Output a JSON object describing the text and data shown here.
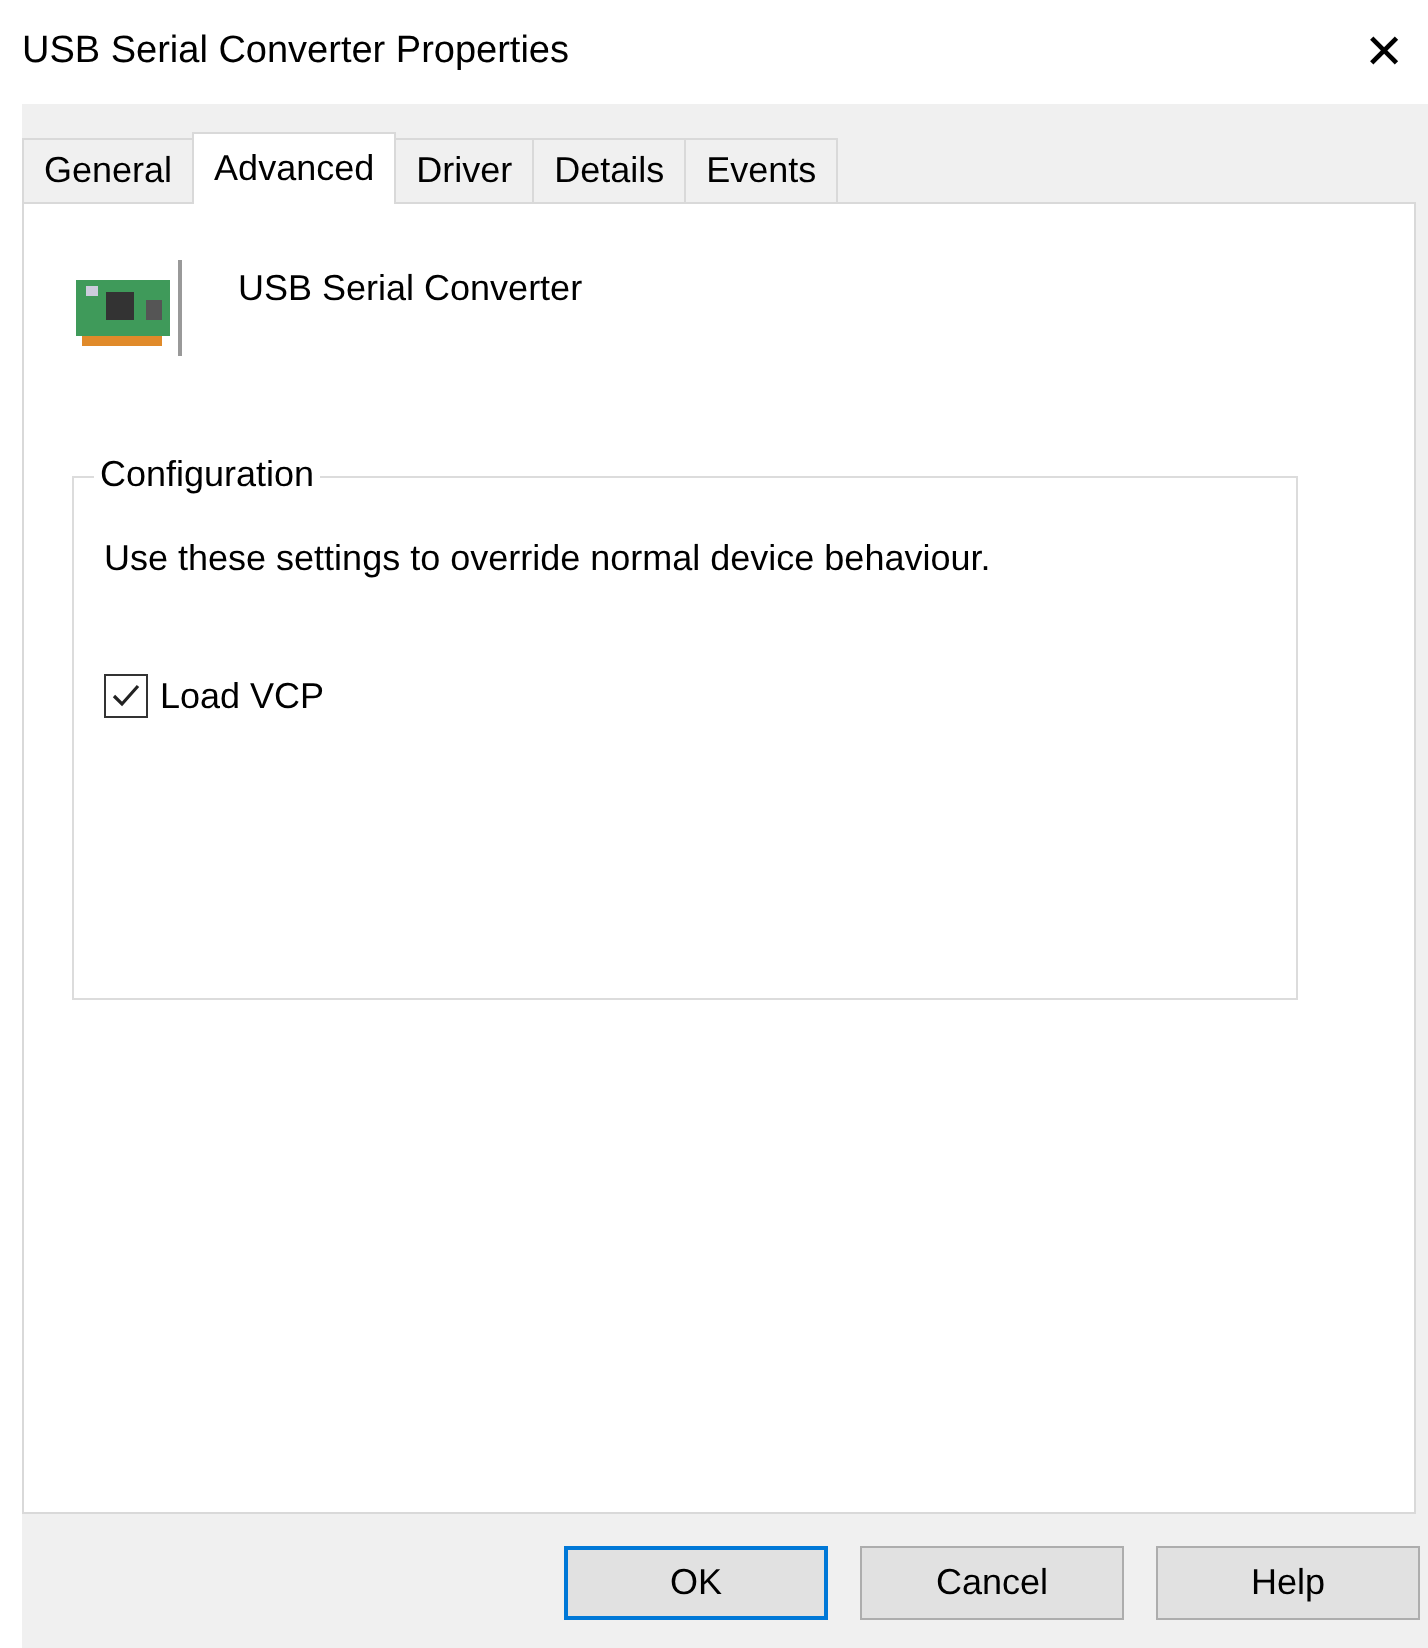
{
  "window": {
    "title": "USB Serial Converter Properties",
    "close": "✕"
  },
  "tabs": [
    {
      "label": "General",
      "selected": false
    },
    {
      "label": "Advanced",
      "selected": true
    },
    {
      "label": "Driver",
      "selected": false
    },
    {
      "label": "Details",
      "selected": false
    },
    {
      "label": "Events",
      "selected": false
    }
  ],
  "device": {
    "name": "USB Serial Converter"
  },
  "group": {
    "title": "Configuration",
    "description": "Use these settings to override normal device behaviour.",
    "options": [
      {
        "kind": "checkbox",
        "label": "Load VCP",
        "checked": true
      }
    ]
  },
  "buttons": [
    {
      "label": "OK",
      "focused": true
    },
    {
      "label": "Cancel",
      "focused": false
    },
    {
      "label": "Help",
      "focused": false
    }
  ]
}
